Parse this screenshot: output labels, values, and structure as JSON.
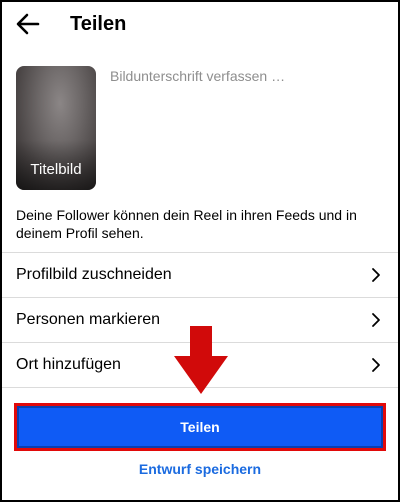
{
  "header": {
    "title": "Teilen",
    "back_icon": "arrow-left-icon"
  },
  "media": {
    "cover_label": "Titelbild"
  },
  "caption": {
    "placeholder": "Bildunterschrift verfassen …"
  },
  "info_text": "Deine Follower können dein Reel in ihren Feeds und in deinem Profil sehen.",
  "options": [
    {
      "label": "Profilbild zuschneiden",
      "icon": "chevron-right-icon"
    },
    {
      "label": "Personen markieren",
      "icon": "chevron-right-icon"
    },
    {
      "label": "Ort hinzufügen",
      "icon": "chevron-right-icon"
    }
  ],
  "actions": {
    "share_label": "Teilen",
    "draft_label": "Entwurf speichern"
  },
  "colors": {
    "primary": "#0f5bf5",
    "highlight": "#e10909",
    "link": "#1b6be0",
    "divider": "#dbdbdb"
  },
  "annotation": {
    "icon": "down-arrow-annotation-icon"
  }
}
